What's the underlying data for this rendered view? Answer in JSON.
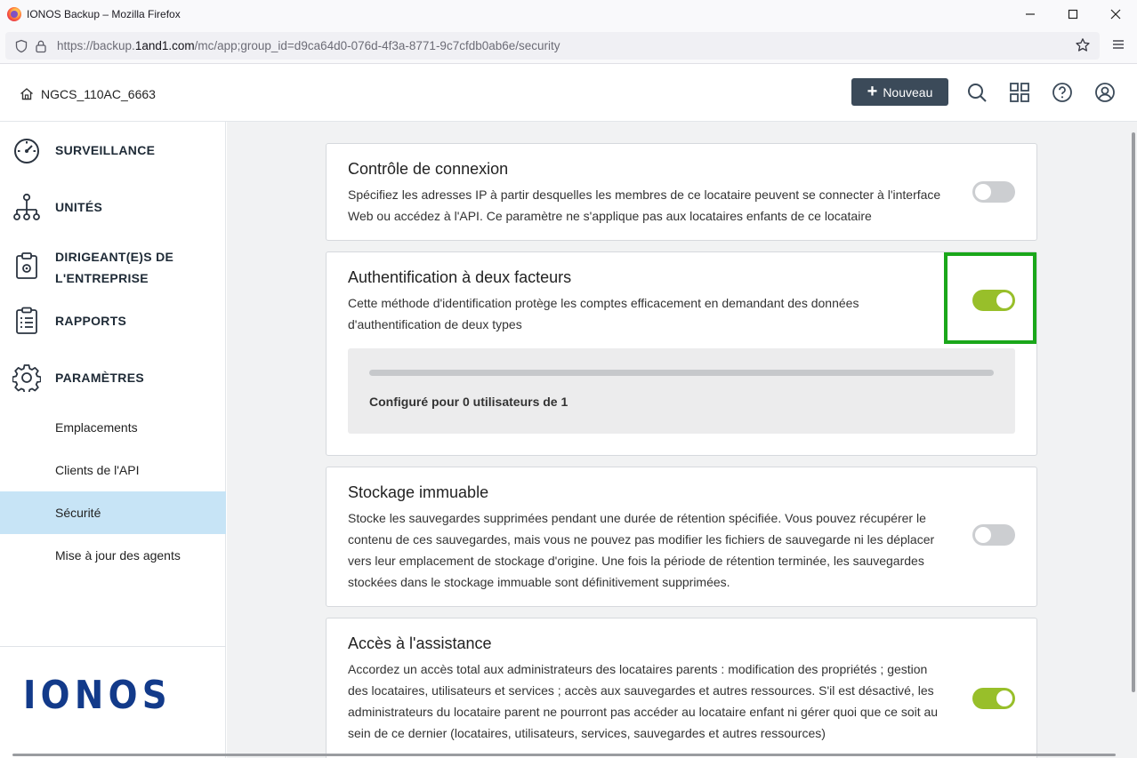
{
  "browser": {
    "window_title": "IONOS Backup – Mozilla Firefox",
    "url_prefix": "https://backup.",
    "url_domain": "1and1.com",
    "url_suffix": "/mc/app;group_id=d9ca64d0-076d-4f3a-8771-9c7cfdb0ab6e/security"
  },
  "header": {
    "tenant_name": "NGCS_110AC_6663",
    "new_button_label": "Nouveau"
  },
  "sidebar": {
    "items": [
      {
        "label": "SURVEILLANCE",
        "icon": "gauge-icon"
      },
      {
        "label": "UNITÉS",
        "icon": "hierarchy-icon"
      },
      {
        "label": "DIRIGEANT(E)S DE L'ENTREPRISE",
        "icon": "clipboard-gear-icon"
      },
      {
        "label": "RAPPORTS",
        "icon": "report-icon"
      },
      {
        "label": "PARAMÈTRES",
        "icon": "gear-icon"
      }
    ],
    "sub_items": [
      {
        "label": "Emplacements",
        "active": false
      },
      {
        "label": "Clients de l'API",
        "active": false
      },
      {
        "label": "Sécurité",
        "active": true
      },
      {
        "label": "Mise à jour des agents",
        "active": false
      }
    ],
    "brand": "IONOS"
  },
  "settings": {
    "login_control": {
      "title": "Contrôle de connexion",
      "description": "Spécifiez les adresses IP à partir desquelles les membres de ce locataire peuvent se connecter à l'interface Web ou accédez à l'API. Ce paramètre ne s'applique pas aux locataires enfants de ce locataire",
      "enabled": false
    },
    "two_factor": {
      "title": "Authentification à deux facteurs",
      "description": "Cette méthode d'identification protège les comptes efficacement en demandant des données d'authentification de deux types",
      "enabled": true,
      "progress": 0,
      "status": "Configuré pour 0 utilisateurs de 1"
    },
    "immutable_storage": {
      "title": "Stockage immuable",
      "description": "Stocke les sauvegardes supprimées pendant une durée de rétention spécifiée. Vous pouvez récupérer le contenu de ces sauvegardes, mais vous ne pouvez pas modifier les fichiers de sauvegarde ni les déplacer vers leur emplacement de stockage d'origine. Une fois la période de rétention terminée, les sauvegardes stockées dans le stockage immuable sont définitivement supprimées.",
      "enabled": false
    },
    "support_access": {
      "title": "Accès à l'assistance",
      "description": "Accordez un accès total aux administrateurs des locataires parents : modification des propriétés ; gestion des locataires, utilisateurs et services ; accès aux sauvegardes et autres ressources. S'il est désactivé, les administrateurs du locataire parent ne pourront pas accéder au locataire enfant ni gérer quoi que ce soit au sein de ce dernier (locataires, utilisateurs, services, sauvegardes et autres ressources)",
      "enabled": true
    }
  },
  "colors": {
    "toggle_on": "#98bf2a",
    "toggle_off": "#ccced1",
    "highlight": "#1aa71a",
    "active_nav": "#c7e4f6",
    "brand": "#123a8a"
  }
}
